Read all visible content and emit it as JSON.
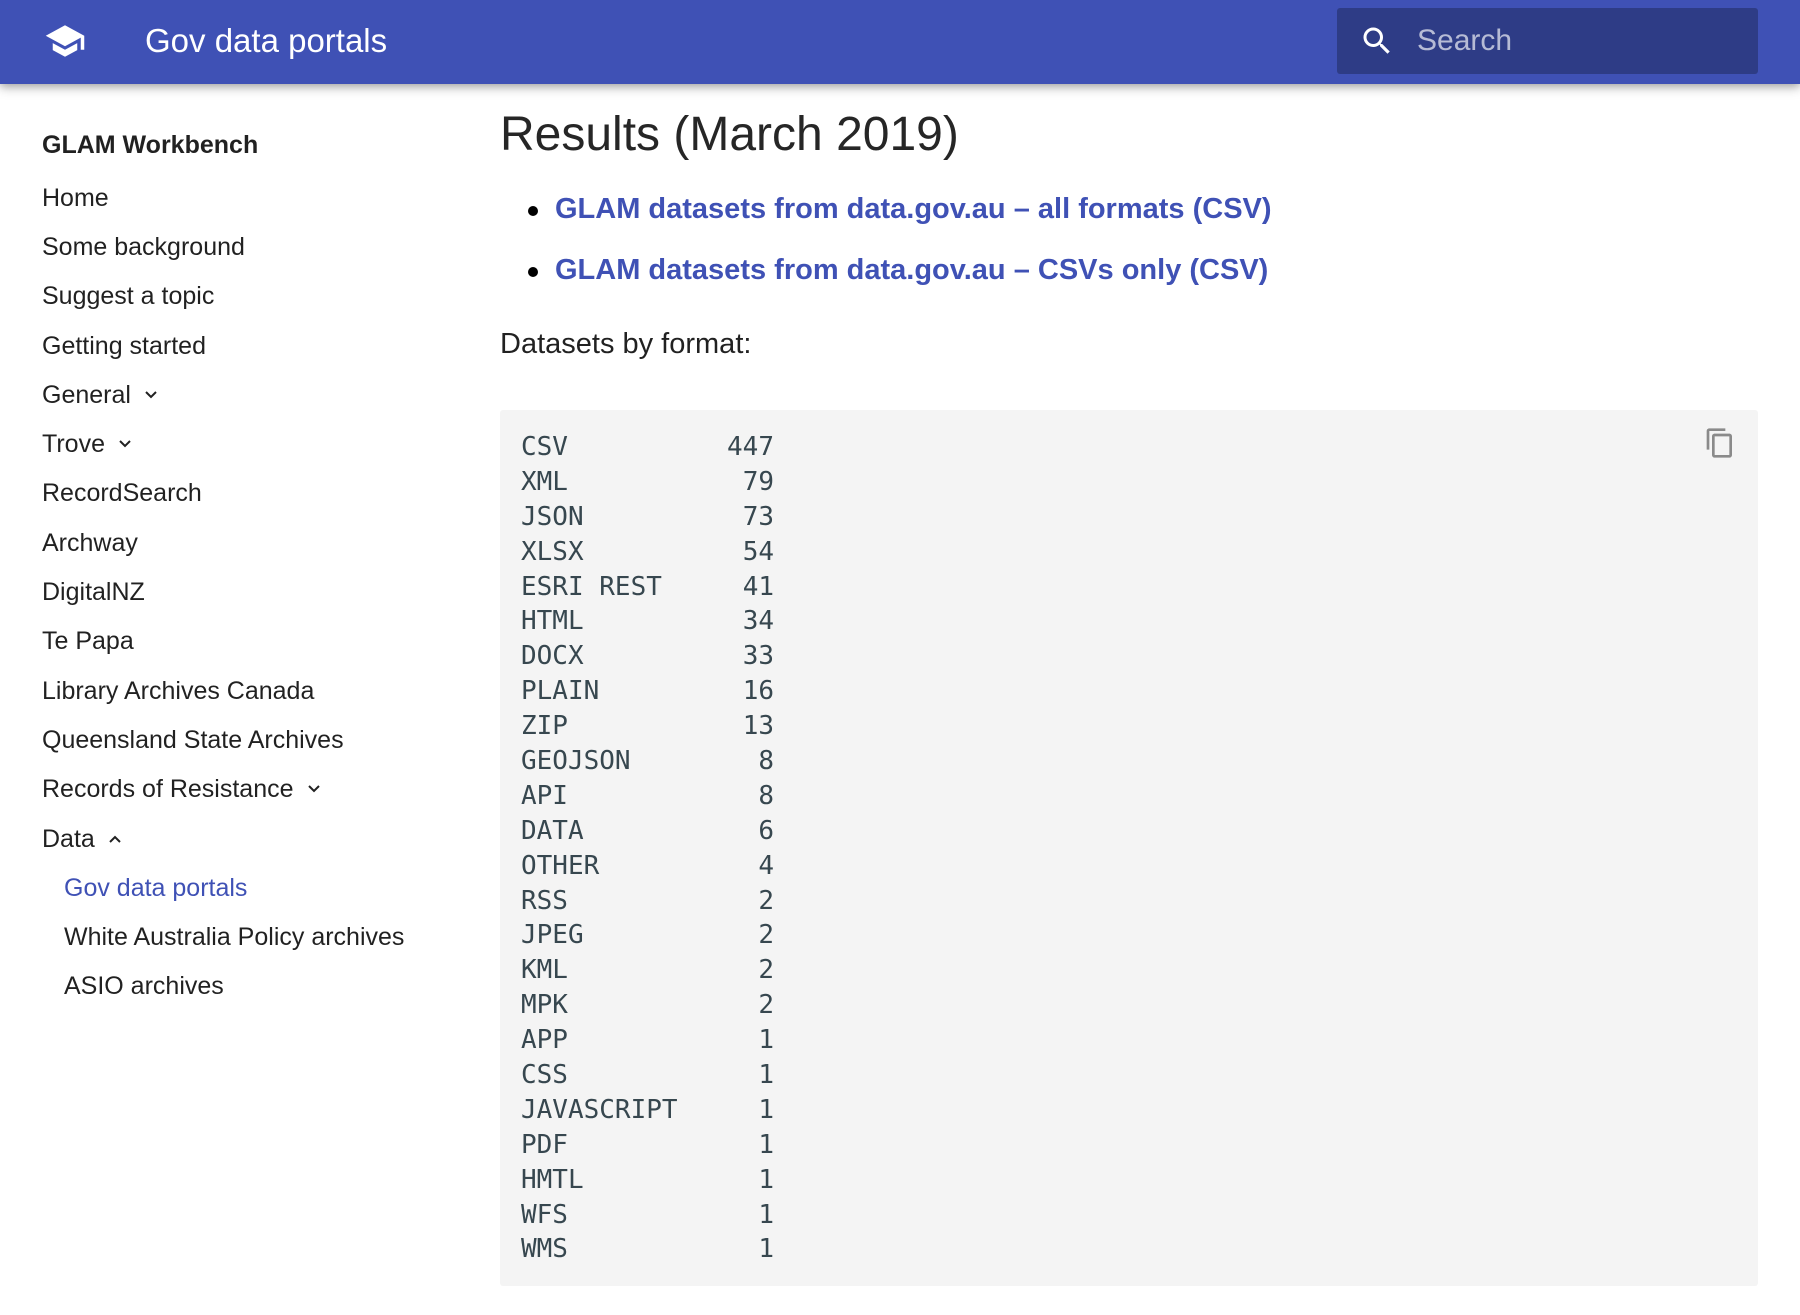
{
  "header": {
    "title": "Gov data portals",
    "search_placeholder": "Search",
    "accent_color": "#3f51b5"
  },
  "sidebar": {
    "title": "GLAM Workbench",
    "items": [
      {
        "label": "Home"
      },
      {
        "label": "Some background"
      },
      {
        "label": "Suggest a topic"
      },
      {
        "label": "Getting started"
      },
      {
        "label": "General",
        "expandable": "collapsed"
      },
      {
        "label": "Trove",
        "expandable": "collapsed"
      },
      {
        "label": "RecordSearch"
      },
      {
        "label": "Archway"
      },
      {
        "label": "DigitalNZ"
      },
      {
        "label": "Te Papa"
      },
      {
        "label": "Library Archives Canada"
      },
      {
        "label": "Queensland State Archives"
      },
      {
        "label": "Records of Resistance",
        "expandable": "collapsed"
      },
      {
        "label": "Data",
        "expandable": "expanded"
      }
    ],
    "subitems": [
      {
        "label": "Gov data portals",
        "active": true
      },
      {
        "label": "White Australia Policy archives"
      },
      {
        "label": "ASIO archives"
      }
    ]
  },
  "main": {
    "heading": "Results (March 2019)",
    "links": [
      {
        "label": "GLAM datasets from data.gov.au – all formats (CSV)"
      },
      {
        "label": "GLAM datasets from data.gov.au – CSVs only (CSV)"
      }
    ],
    "section_label": "Datasets by format:",
    "formats": [
      {
        "format": "CSV",
        "count": "447"
      },
      {
        "format": "XML",
        "count": "79"
      },
      {
        "format": "JSON",
        "count": "73"
      },
      {
        "format": "XLSX",
        "count": "54"
      },
      {
        "format": "ESRI REST",
        "count": "41"
      },
      {
        "format": "HTML",
        "count": "34"
      },
      {
        "format": "DOCX",
        "count": "33"
      },
      {
        "format": "PLAIN",
        "count": "16"
      },
      {
        "format": "ZIP",
        "count": "13"
      },
      {
        "format": "GEOJSON",
        "count": "8"
      },
      {
        "format": "API",
        "count": "8"
      },
      {
        "format": "DATA",
        "count": "6"
      },
      {
        "format": "OTHER",
        "count": "4"
      },
      {
        "format": "RSS",
        "count": "2"
      },
      {
        "format": "JPEG",
        "count": "2"
      },
      {
        "format": "KML",
        "count": "2"
      },
      {
        "format": "MPK",
        "count": "2"
      },
      {
        "format": "APP",
        "count": "1"
      },
      {
        "format": "CSS",
        "count": "1"
      },
      {
        "format": "JAVASCRIPT",
        "count": "1"
      },
      {
        "format": "PDF",
        "count": "1"
      },
      {
        "format": "HMTL",
        "count": "1"
      },
      {
        "format": "WFS",
        "count": "1"
      },
      {
        "format": "WMS",
        "count": "1"
      }
    ],
    "copy_icon": "copy-icon"
  }
}
